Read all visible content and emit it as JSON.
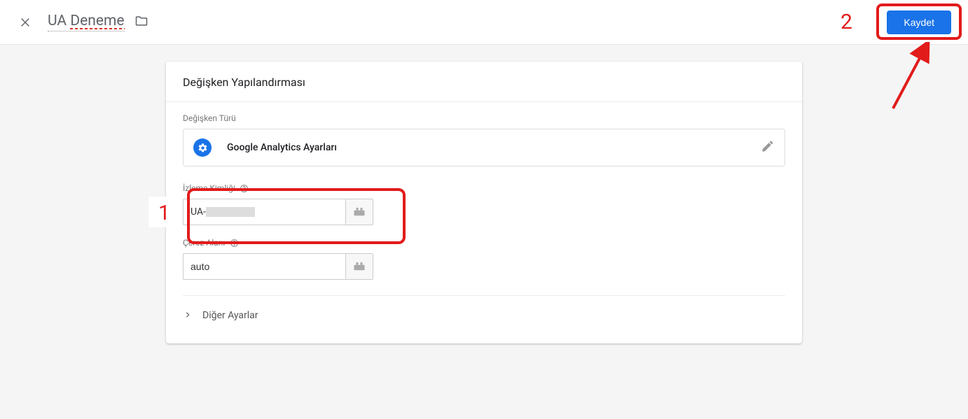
{
  "header": {
    "title": "UA Deneme",
    "save_label": "Kaydet"
  },
  "card": {
    "title": "Değişken Yapılandırması",
    "type_label": "Değişken Türü",
    "type_name": "Google Analytics Ayarları",
    "tracking_id": {
      "label": "İzleme Kimliği",
      "prefix": "UA-"
    },
    "cookie_domain": {
      "label": "Çerez Alanı",
      "value": "auto"
    },
    "more_settings": "Diğer Ayarlar"
  },
  "annotations": {
    "step1": "1",
    "step2": "2"
  }
}
